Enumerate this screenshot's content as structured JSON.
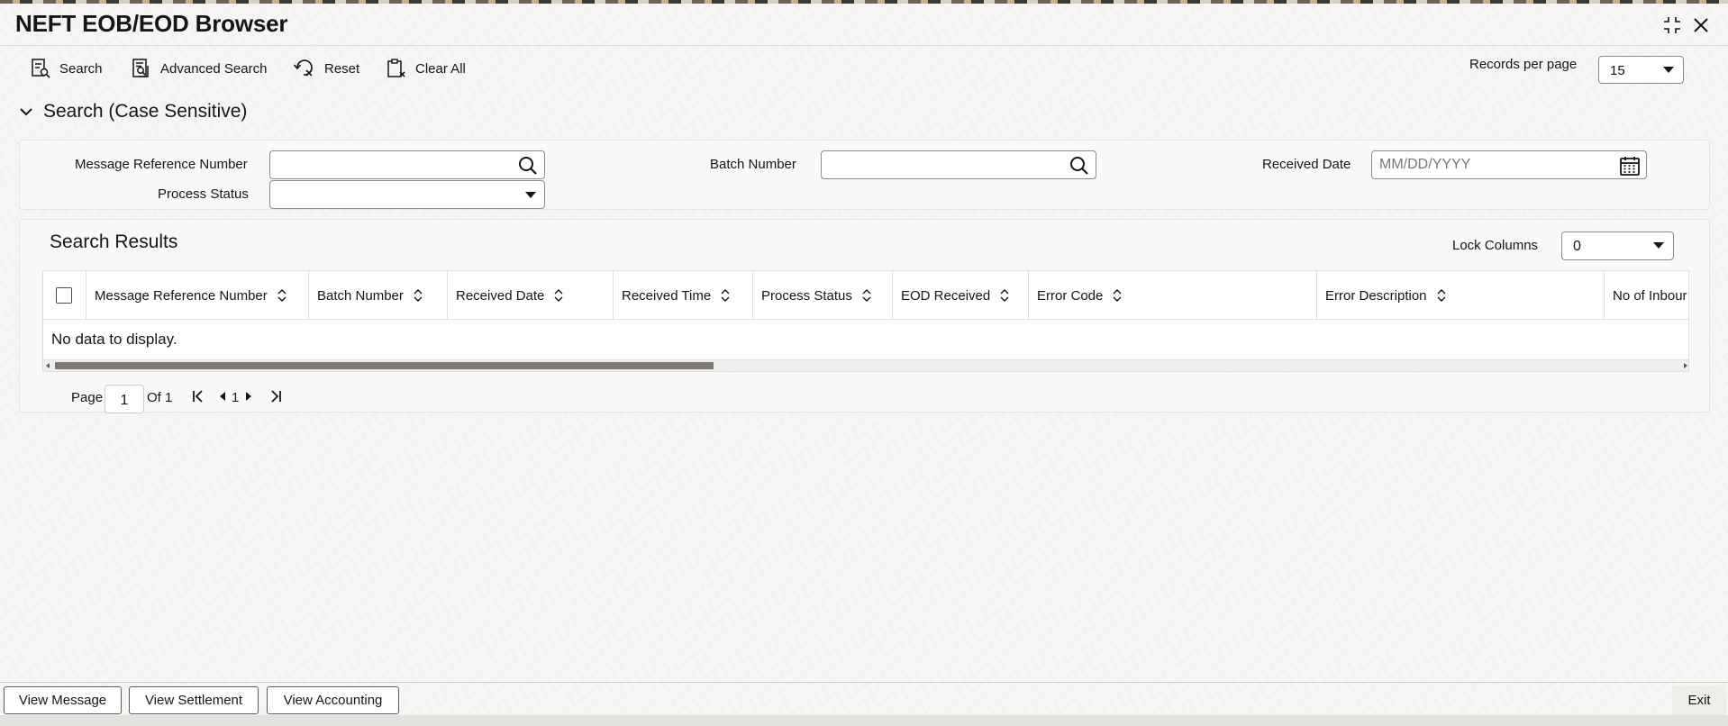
{
  "window": {
    "title": "NEFT EOB/EOD Browser",
    "maximize_icon": "maximize-icon",
    "close_icon": "close-icon"
  },
  "toolbar": {
    "search_label": "Search",
    "advanced_search_label": "Advanced Search",
    "reset_label": "Reset",
    "clear_all_label": "Clear All",
    "records_per_page_label": "Records per page",
    "records_per_page_value": "15"
  },
  "search_section": {
    "title": "Search (Case Sensitive)",
    "fields": {
      "message_reference_number": {
        "label": "Message Reference Number",
        "value": "",
        "placeholder": ""
      },
      "batch_number": {
        "label": "Batch Number",
        "value": "",
        "placeholder": ""
      },
      "received_date": {
        "label": "Received Date",
        "value": "",
        "placeholder": "MM/DD/YYYY"
      },
      "process_status": {
        "label": "Process Status",
        "value": ""
      }
    }
  },
  "results": {
    "title": "Search Results",
    "lock_columns_label": "Lock Columns",
    "lock_columns_value": "0",
    "columns": [
      "Message Reference Number",
      "Batch Number",
      "Received Date",
      "Received Time",
      "Process Status",
      "EOD Received",
      "Error Code",
      "Error Description",
      "No of Inbour"
    ],
    "rows": [],
    "empty_message": "No data to display.",
    "pagination": {
      "page_label": "Page",
      "current_page": "1",
      "of_label": "Of 1",
      "page_number": "1"
    }
  },
  "footer": {
    "view_message_label": "View Message",
    "view_settlement_label": "View Settlement",
    "view_accounting_label": "View Accounting",
    "exit_label": "Exit"
  },
  "colors": {
    "text": "#161513",
    "border": "#8e8a85",
    "background": "#f7f6f5",
    "scroll_thumb": "#7c7975"
  }
}
